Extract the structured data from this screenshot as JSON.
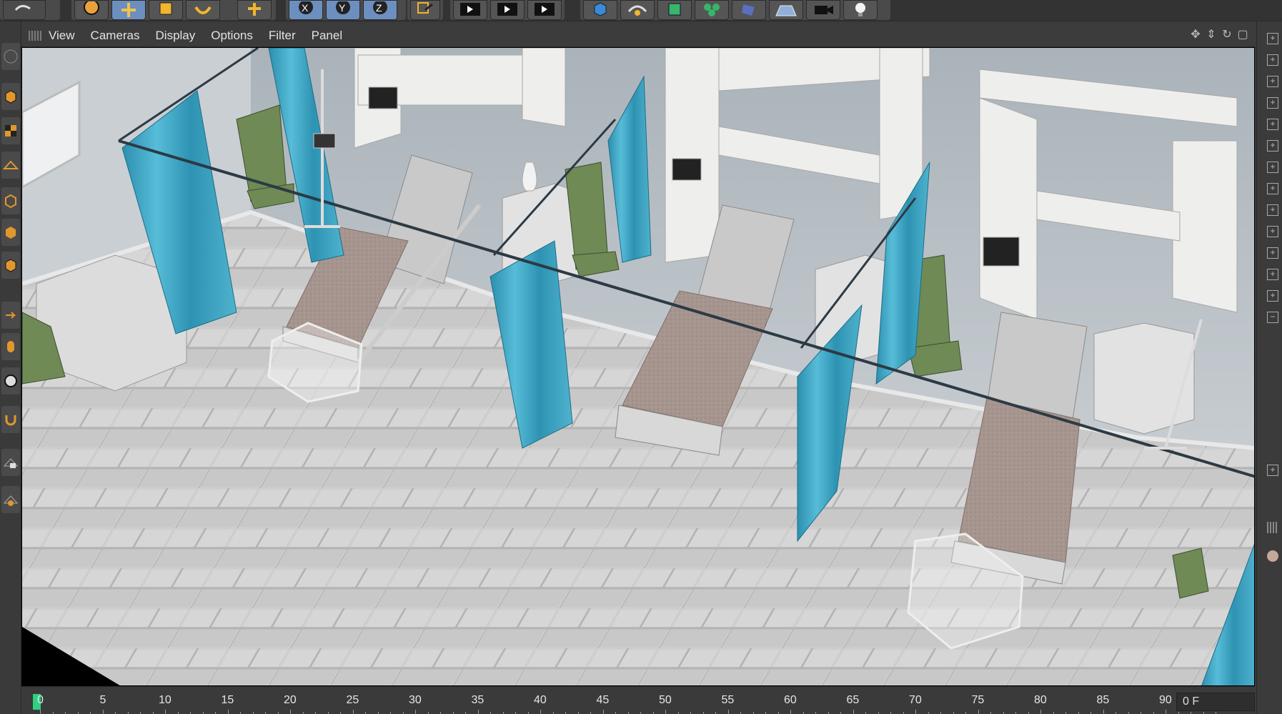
{
  "toolbar": {
    "buttons": [
      "undo-icon",
      "cursor-select-icon",
      "move-icon",
      "scale-icon",
      "rotate-icon",
      "move-alt-icon",
      "x-axis-lock",
      "y-axis-lock",
      "z-axis-lock",
      "world-coord-icon",
      "render-view-icon",
      "render-picture-viewer-icon",
      "render-settings-icon",
      "cube-icon",
      "nurbs-icon",
      "subdivision-icon",
      "cloner-icon",
      "deformer-icon",
      "floor-icon",
      "camera-icon",
      "light-icon"
    ],
    "axis_labels": {
      "x": "X",
      "y": "Y",
      "z": "Z"
    }
  },
  "viewport_menu": {
    "items": [
      "View",
      "Cameras",
      "Display",
      "Options",
      "Filter",
      "Panel"
    ]
  },
  "timeline": {
    "ticks": [
      "0",
      "5",
      "10",
      "15",
      "20",
      "25",
      "30",
      "35",
      "40",
      "45",
      "50",
      "55",
      "60",
      "65",
      "70",
      "75",
      "80",
      "85",
      "90"
    ],
    "current_frame": "0 F"
  },
  "colors": {
    "accent": "#2fd080",
    "curtain": "#3aa3c2",
    "bed_blanket": "#a5948f",
    "chair": "#6f8a55",
    "wall": "#bcc3c8",
    "floor": "#cfcfcf"
  }
}
